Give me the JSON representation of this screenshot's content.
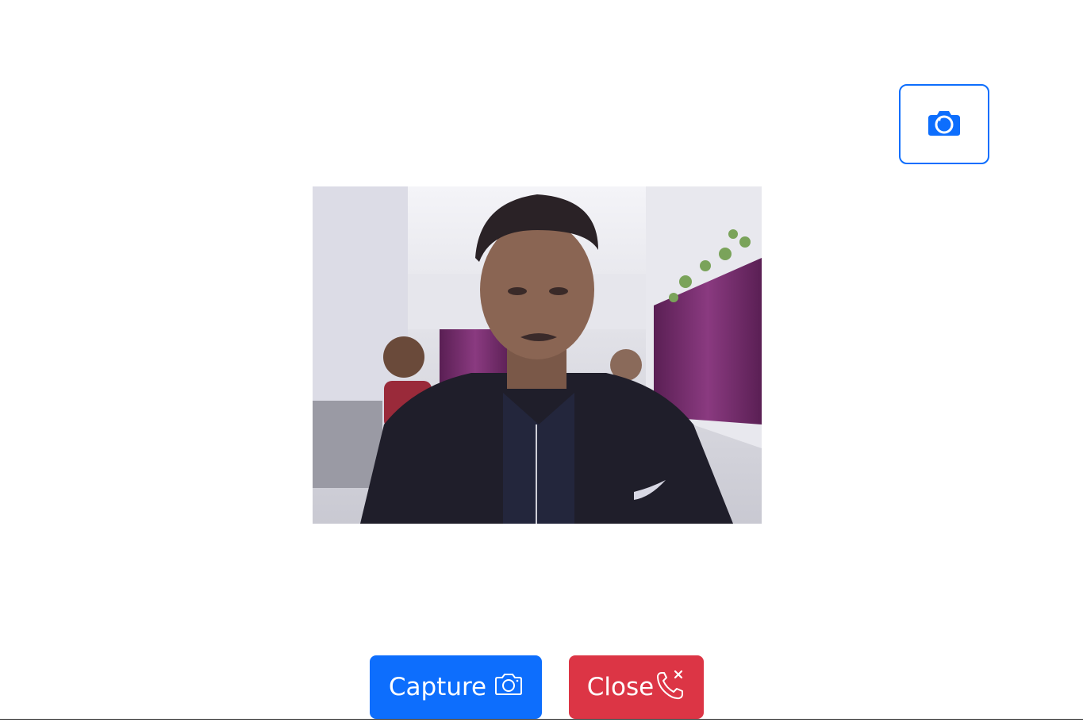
{
  "header": {
    "switch_camera_icon": "camera-reverse-icon"
  },
  "video": {
    "icon": "webcam-feed"
  },
  "controls": {
    "capture_label": "Capture",
    "capture_icon": "camera-icon",
    "close_label": "Close",
    "close_icon": "phone-x-icon"
  },
  "colors": {
    "primary": "#0d6efd",
    "danger": "#dc3545",
    "background": "#ffffff"
  }
}
